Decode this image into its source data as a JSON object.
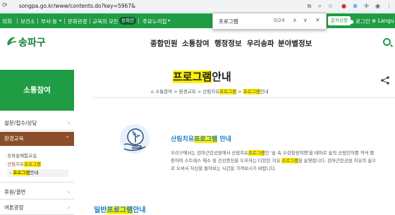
{
  "browser": {
    "url": "songpa.go.kr/www/contents.do?key=5967&",
    "find": {
      "query": "프로그램",
      "count": "0/24"
    }
  },
  "topbar": {
    "items": [
      "의회",
      "보건소",
      "부서·동",
      "문화관광",
      "교육의 모든 것",
      "주요누리집"
    ],
    "badge": "송파런",
    "sms_button": "문자신청",
    "login": "로그인",
    "language": "Langu"
  },
  "header": {
    "logo": "송파구",
    "nav": [
      "종합민원",
      "소통참여",
      "행정정보",
      "우리송파",
      "분야별정보"
    ]
  },
  "sidebar": {
    "title": "소통참여",
    "items": [
      "설문/접수/상담",
      "환경교육",
      "후원/결연",
      "여론광장"
    ],
    "sub": {
      "item1": "송파숲체험교실",
      "item2_pre": "산림치유",
      "item2_hl": "프로그램",
      "item3_hl": "프로그램",
      "item3_post": "안내"
    }
  },
  "main": {
    "title_hl": "프로그램",
    "title_post": "안내",
    "breadcrumb": {
      "b1": "소통참여",
      "b2": "환경교육",
      "b3_pre": "산림치유",
      "b3_hl": "프로그램",
      "b4_hl": "프로그램",
      "b4_post": "안내"
    },
    "section_pre": "산림치유",
    "section_hl": "프로그램",
    "section_post": "안내",
    "desc": {
      "l1_pre": "우리구에서는 천마근린공원에서 산림치유",
      "l1_hl": "프로그램",
      "l1_post": "인 '숲 속 오감힐링여행'을 테마로 숲의 산림인자를 적극 활",
      "l2_pre": "용하여 스트레스 해소 및 건강증진을 도모하는 다양한 치유 ",
      "l2_hl": "프로그램",
      "l2_post": "을 운영합니다. 천마근린공원 치유의 숲으",
      "l3": "로 오셔서 자신을 돌아보는 시간을 가져보시기 바랍니다."
    },
    "sub_pre": "일반",
    "sub_hl": "프로그램",
    "sub_post": "안내"
  }
}
